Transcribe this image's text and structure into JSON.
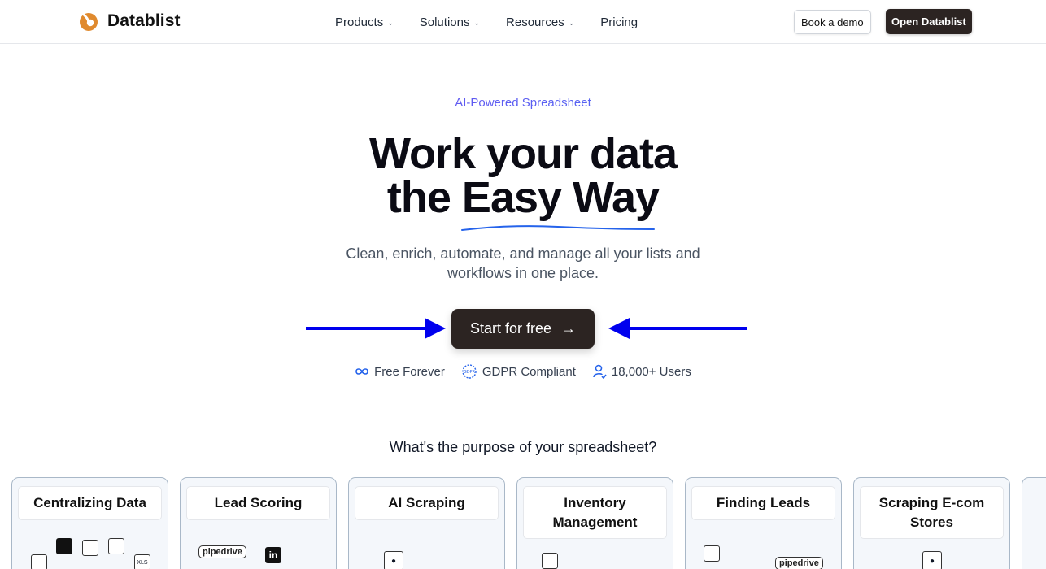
{
  "brand": {
    "name": "Datablist"
  },
  "nav": {
    "items": [
      {
        "label": "Products",
        "has_dropdown": true
      },
      {
        "label": "Solutions",
        "has_dropdown": true
      },
      {
        "label": "Resources",
        "has_dropdown": true
      },
      {
        "label": "Pricing",
        "has_dropdown": false
      }
    ],
    "book_demo": "Book a demo",
    "open_app": "Open Datablist"
  },
  "hero": {
    "eyebrow": "AI-Powered Spreadsheet",
    "headline_line1": "Work your data",
    "headline_line2_prefix": "the ",
    "headline_line2_emphasis": "Easy Way",
    "subtitle": "Clean, enrich, automate, and manage all your lists and workflows in one place.",
    "cta": "Start for free",
    "cta_icon": "arrow-right-icon",
    "badges": [
      {
        "icon": "infinity-icon",
        "label": "Free Forever"
      },
      {
        "icon": "gdpr-icon",
        "label": "GDPR Compliant"
      },
      {
        "icon": "users-icon",
        "label": "18,000+ Users"
      }
    ]
  },
  "purpose": {
    "question": "What's the purpose of your spreadsheet?",
    "cards": [
      {
        "title": "Centralizing Data"
      },
      {
        "title": "Lead Scoring",
        "logo_text": "pipedrive"
      },
      {
        "title": "AI Scraping"
      },
      {
        "title": "Inventory Management"
      },
      {
        "title": "Finding Leads",
        "logo_text": "pipedrive"
      },
      {
        "title": "Scraping E-com Stores"
      }
    ]
  },
  "colors": {
    "brand_dark": "#2c2422",
    "accent_blue": "#2563eb",
    "arrow_blue": "#0000ee",
    "logo_orange": "#e08a2e"
  }
}
